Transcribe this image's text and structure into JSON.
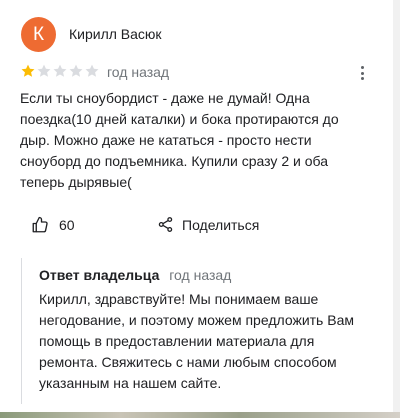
{
  "colors": {
    "avatar_bg": "#ee6b32",
    "star_filled": "#fbbc04",
    "star_empty": "#dadce0"
  },
  "review": {
    "avatar_letter": "К",
    "author": "Кирилл Васюк",
    "rating": 1,
    "rating_max": 5,
    "date": "год назад",
    "text": "Если ты сноубордист - даже не думай! Одна\nпоездка(10 дней каталки) и бока протираются до\nдыр. Можно даже не кататься - просто нести\nсноуборд до подъемника. Купили сразу 2 и оба\nтеперь дырявые(",
    "likes": "60",
    "share_label": "Поделиться",
    "icons": {
      "more": "more-vert-icon",
      "like": "thumb-up-icon",
      "share": "share-icon"
    }
  },
  "owner_reply": {
    "label": "Ответ владельца",
    "date": "год назад",
    "text": "Кирилл, здравствуйте! Мы понимаем ваше\nнегодование, и поэтому можем предложить Вам\nпомощь в предоставлении материала для\nремонта. Свяжитесь с нами любым способом\nуказанным на нашем сайте."
  }
}
